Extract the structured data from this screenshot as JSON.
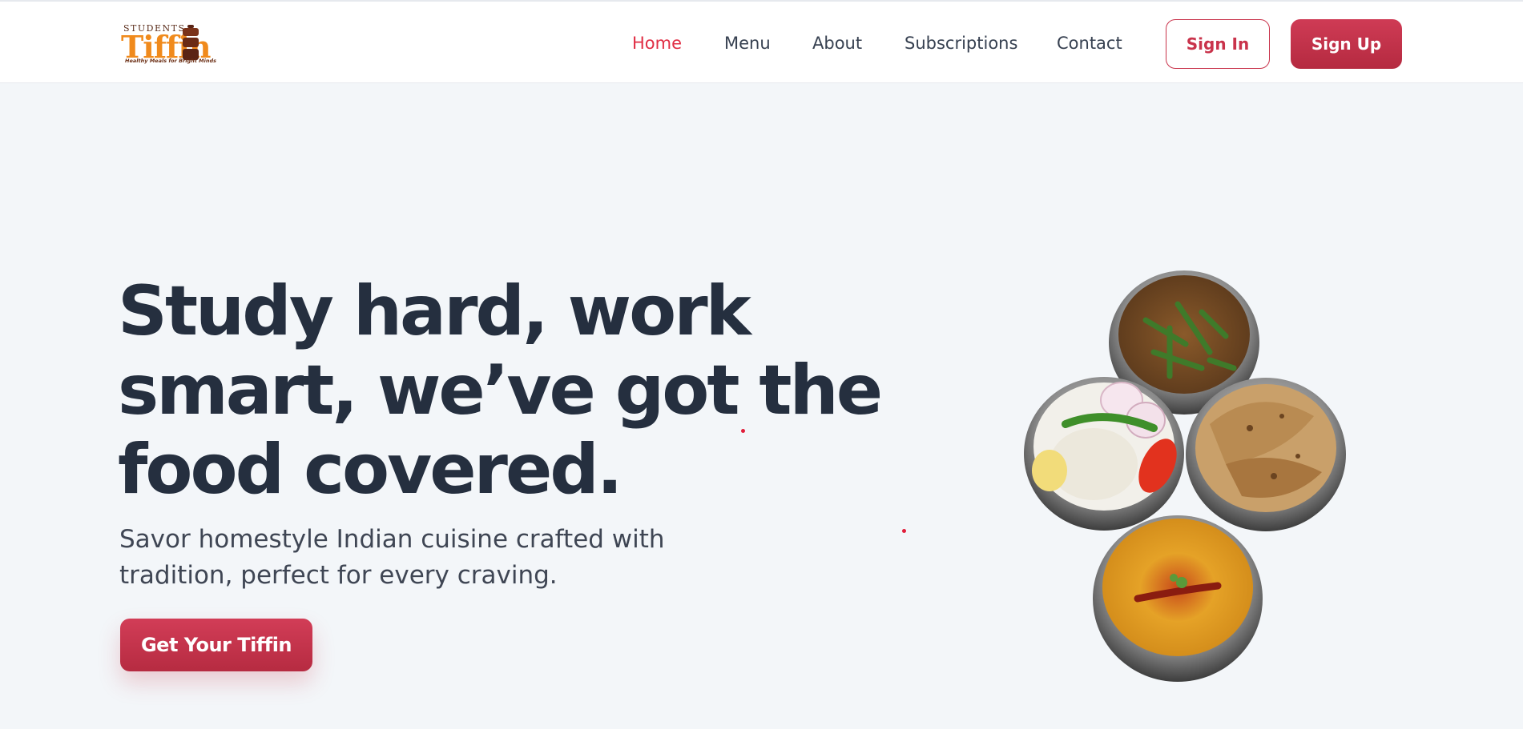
{
  "brand": {
    "small": "STUDENTS",
    "name": "Tiffin",
    "tagline": "Healthy Meals for Bright Minds"
  },
  "nav": {
    "links": [
      {
        "label": "Home",
        "active": true
      },
      {
        "label": "Menu",
        "active": false
      },
      {
        "label": "About",
        "active": false
      },
      {
        "label": "Subscriptions",
        "active": false
      },
      {
        "label": "Contact",
        "active": false
      }
    ],
    "signin_label": "Sign In",
    "signup_label": "Sign Up"
  },
  "hero": {
    "title": "Study hard, work smart, we’ve got the food covered.",
    "subtitle": "Savor homestyle Indian cuisine crafted with tradition, perfect for every craving.",
    "cta_label": "Get Your Tiffin"
  },
  "colors": {
    "accent": "#c9334b",
    "active_link": "#e02e44",
    "background": "#f3f6f9",
    "heading": "#252f3f"
  },
  "illustration": {
    "dishes": [
      "okra-sabzi-bowl",
      "rice-salad-bowl",
      "chapati-bowl",
      "dal-tadka-bowl"
    ]
  }
}
